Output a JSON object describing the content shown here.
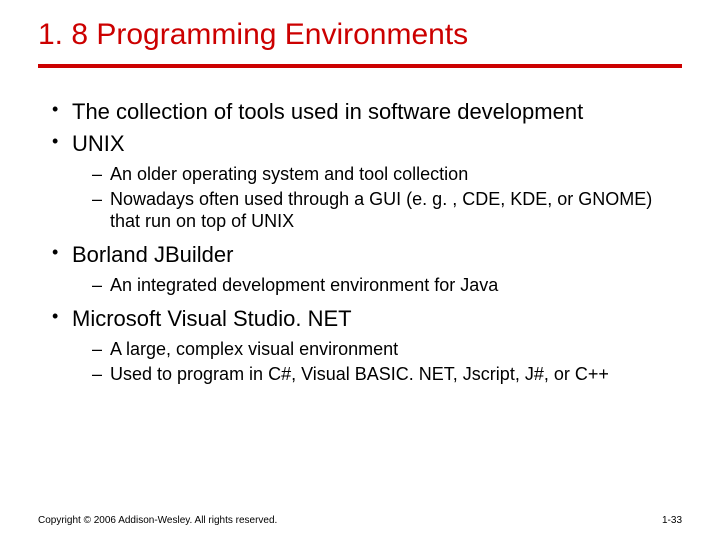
{
  "title": "1. 8 Programming Environments",
  "bullets": [
    {
      "text": "The collection of tools used in software development",
      "sub": []
    },
    {
      "text": "UNIX",
      "sub": [
        "An older operating system and tool collection",
        "Nowadays often used through a GUI (e. g. , CDE, KDE, or GNOME) that run on top of UNIX"
      ]
    },
    {
      "text": "Borland JBuilder",
      "sub": [
        "An integrated development environment for Java"
      ]
    },
    {
      "text": "Microsoft Visual Studio. NET",
      "sub": [
        "A large, complex visual environment",
        "Used to program in C#, Visual BASIC. NET, Jscript, J#, or C++"
      ]
    }
  ],
  "footer": {
    "copyright": "Copyright © 2006 Addison-Wesley. All rights reserved.",
    "page": "1-33"
  }
}
